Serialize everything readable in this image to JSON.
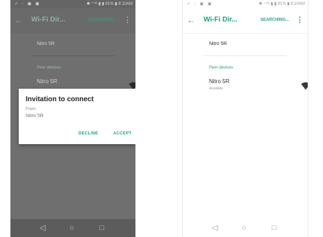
{
  "left": {
    "status_left": "✓ ◦ ▣ ▣",
    "status_right": "✱ ⁺⁴ᴳ ▮ ▮ 91% ▮ 8:10AM",
    "back_icon": "←",
    "title": "Wi-Fi Dir...",
    "status_action": "SEARCHING...",
    "overflow_icon": "⋮",
    "device_name": "Nitro 5R",
    "section_header": "Peer devices",
    "peer": {
      "name": "Nitro 5R",
      "status": ""
    },
    "dialog": {
      "title": "Invitation to connect",
      "from_label": "From:",
      "from_value": "Nitro 5R",
      "decline_label": "DECLINE",
      "accept_label": "ACCEPT"
    },
    "nav": {
      "back": "◁",
      "home": "○",
      "recents": "□"
    }
  },
  "right": {
    "status_left": "✓ ◦ ▣ ▣",
    "status_right": "✱ ⁺⁴ᴳ ▮ ▮ 91% ▮ 8:10AM",
    "back_icon": "←",
    "title": "Wi-Fi Dir...",
    "status_action": "SEARCHING...",
    "overflow_icon": "⋮",
    "device_name": "Nitro 5R",
    "section_header": "Peer devices",
    "peer": {
      "name": "Nitro 5R",
      "status": "Available"
    },
    "nav": {
      "back": "◁",
      "home": "○",
      "recents": "□"
    }
  },
  "colors": {
    "accent": "#1da676",
    "dimmed_background": "#6f6f6f",
    "dialog_background": "#ffffff"
  },
  "icons": {
    "wifi": "wifi-signal-icon",
    "back": "arrow-back-icon",
    "overflow": "more-vert-icon"
  }
}
